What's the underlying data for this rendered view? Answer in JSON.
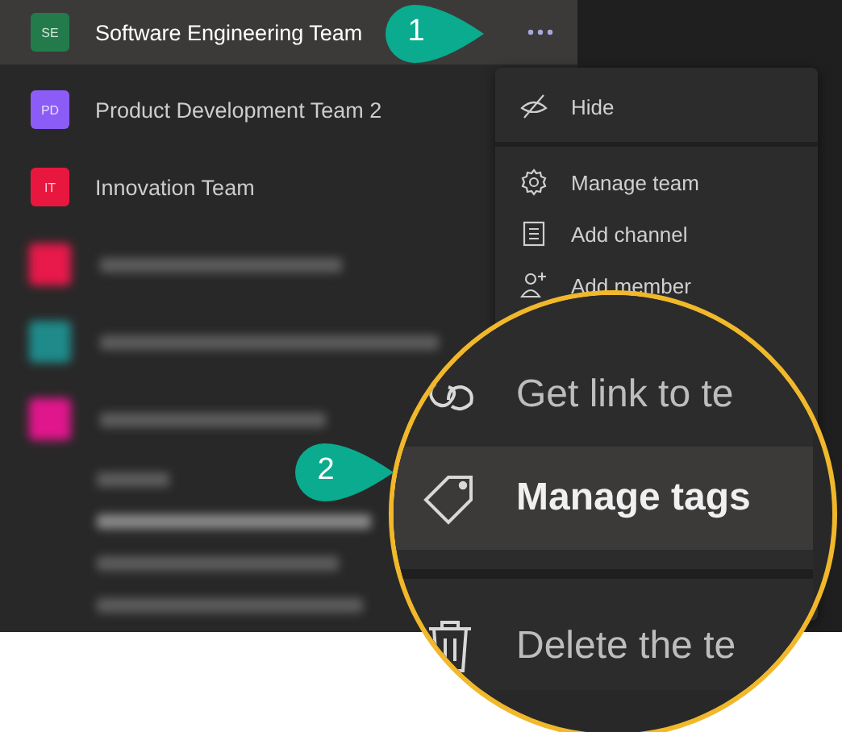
{
  "teams": [
    {
      "initials": "SE",
      "name": "Software Engineering Team",
      "color": "#237b4b",
      "selected": true
    },
    {
      "initials": "PD",
      "name": "Product Development Team 2",
      "color": "#8b5cf6",
      "selected": false
    },
    {
      "initials": "IT",
      "name": "Innovation Team",
      "color": "#e8173f",
      "selected": false
    }
  ],
  "blurred_rows": [
    {
      "kind": "team",
      "color": "#e8194b"
    },
    {
      "kind": "team",
      "color": "#1f8a8a"
    },
    {
      "kind": "team",
      "color": "#e0168c"
    },
    {
      "kind": "channel"
    },
    {
      "kind": "channel"
    },
    {
      "kind": "channel"
    },
    {
      "kind": "channel"
    }
  ],
  "menu": {
    "items": [
      {
        "kind": "item",
        "label": "Hide"
      },
      {
        "kind": "divider"
      },
      {
        "kind": "item",
        "label": "Manage team"
      },
      {
        "kind": "item",
        "label": "Add channel"
      },
      {
        "kind": "item",
        "label": "Add member"
      }
    ]
  },
  "magnifier": {
    "items": [
      {
        "kind": "item",
        "label": "Get link to te",
        "selected": false
      },
      {
        "kind": "item",
        "label": "Manage tags",
        "selected": true
      },
      {
        "kind": "divider"
      },
      {
        "kind": "item",
        "label": "Delete the te",
        "selected": false
      }
    ]
  },
  "callouts": [
    {
      "label": "1"
    },
    {
      "label": "2"
    }
  ]
}
